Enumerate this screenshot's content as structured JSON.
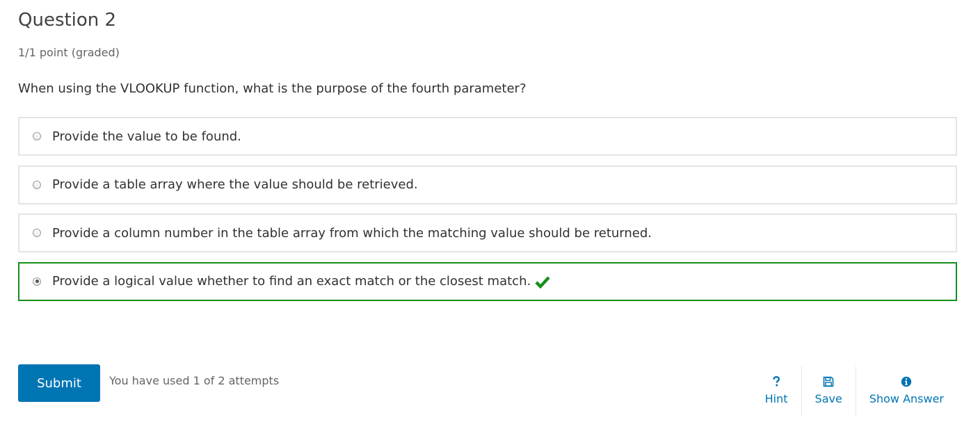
{
  "question": {
    "title": "Question 2",
    "score": "1/1 point (graded)",
    "prompt": "When using the VLOOKUP function, what is the purpose of the fourth parameter?",
    "choices": [
      {
        "label": "Provide the value to be found.",
        "selected": false
      },
      {
        "label": "Provide a table array where the value should be retrieved.",
        "selected": false
      },
      {
        "label": "Provide a column number in the table array from which the matching value should be returned.",
        "selected": false
      },
      {
        "label": "Provide a logical value whether to find an exact match or the closest match.",
        "selected": true,
        "correct": true
      }
    ]
  },
  "footer": {
    "submit_label": "Submit",
    "attempts_text": "You have used 1 of 2 attempts",
    "actions": [
      {
        "label": "Hint",
        "icon": "question-icon"
      },
      {
        "label": "Save",
        "icon": "floppy-disk-icon"
      },
      {
        "label": "Show Answer",
        "icon": "info-circle-icon"
      }
    ]
  },
  "colors": {
    "accent": "#0075b4",
    "correct": "#178f1b",
    "choice_border": "#e4e4e4"
  }
}
